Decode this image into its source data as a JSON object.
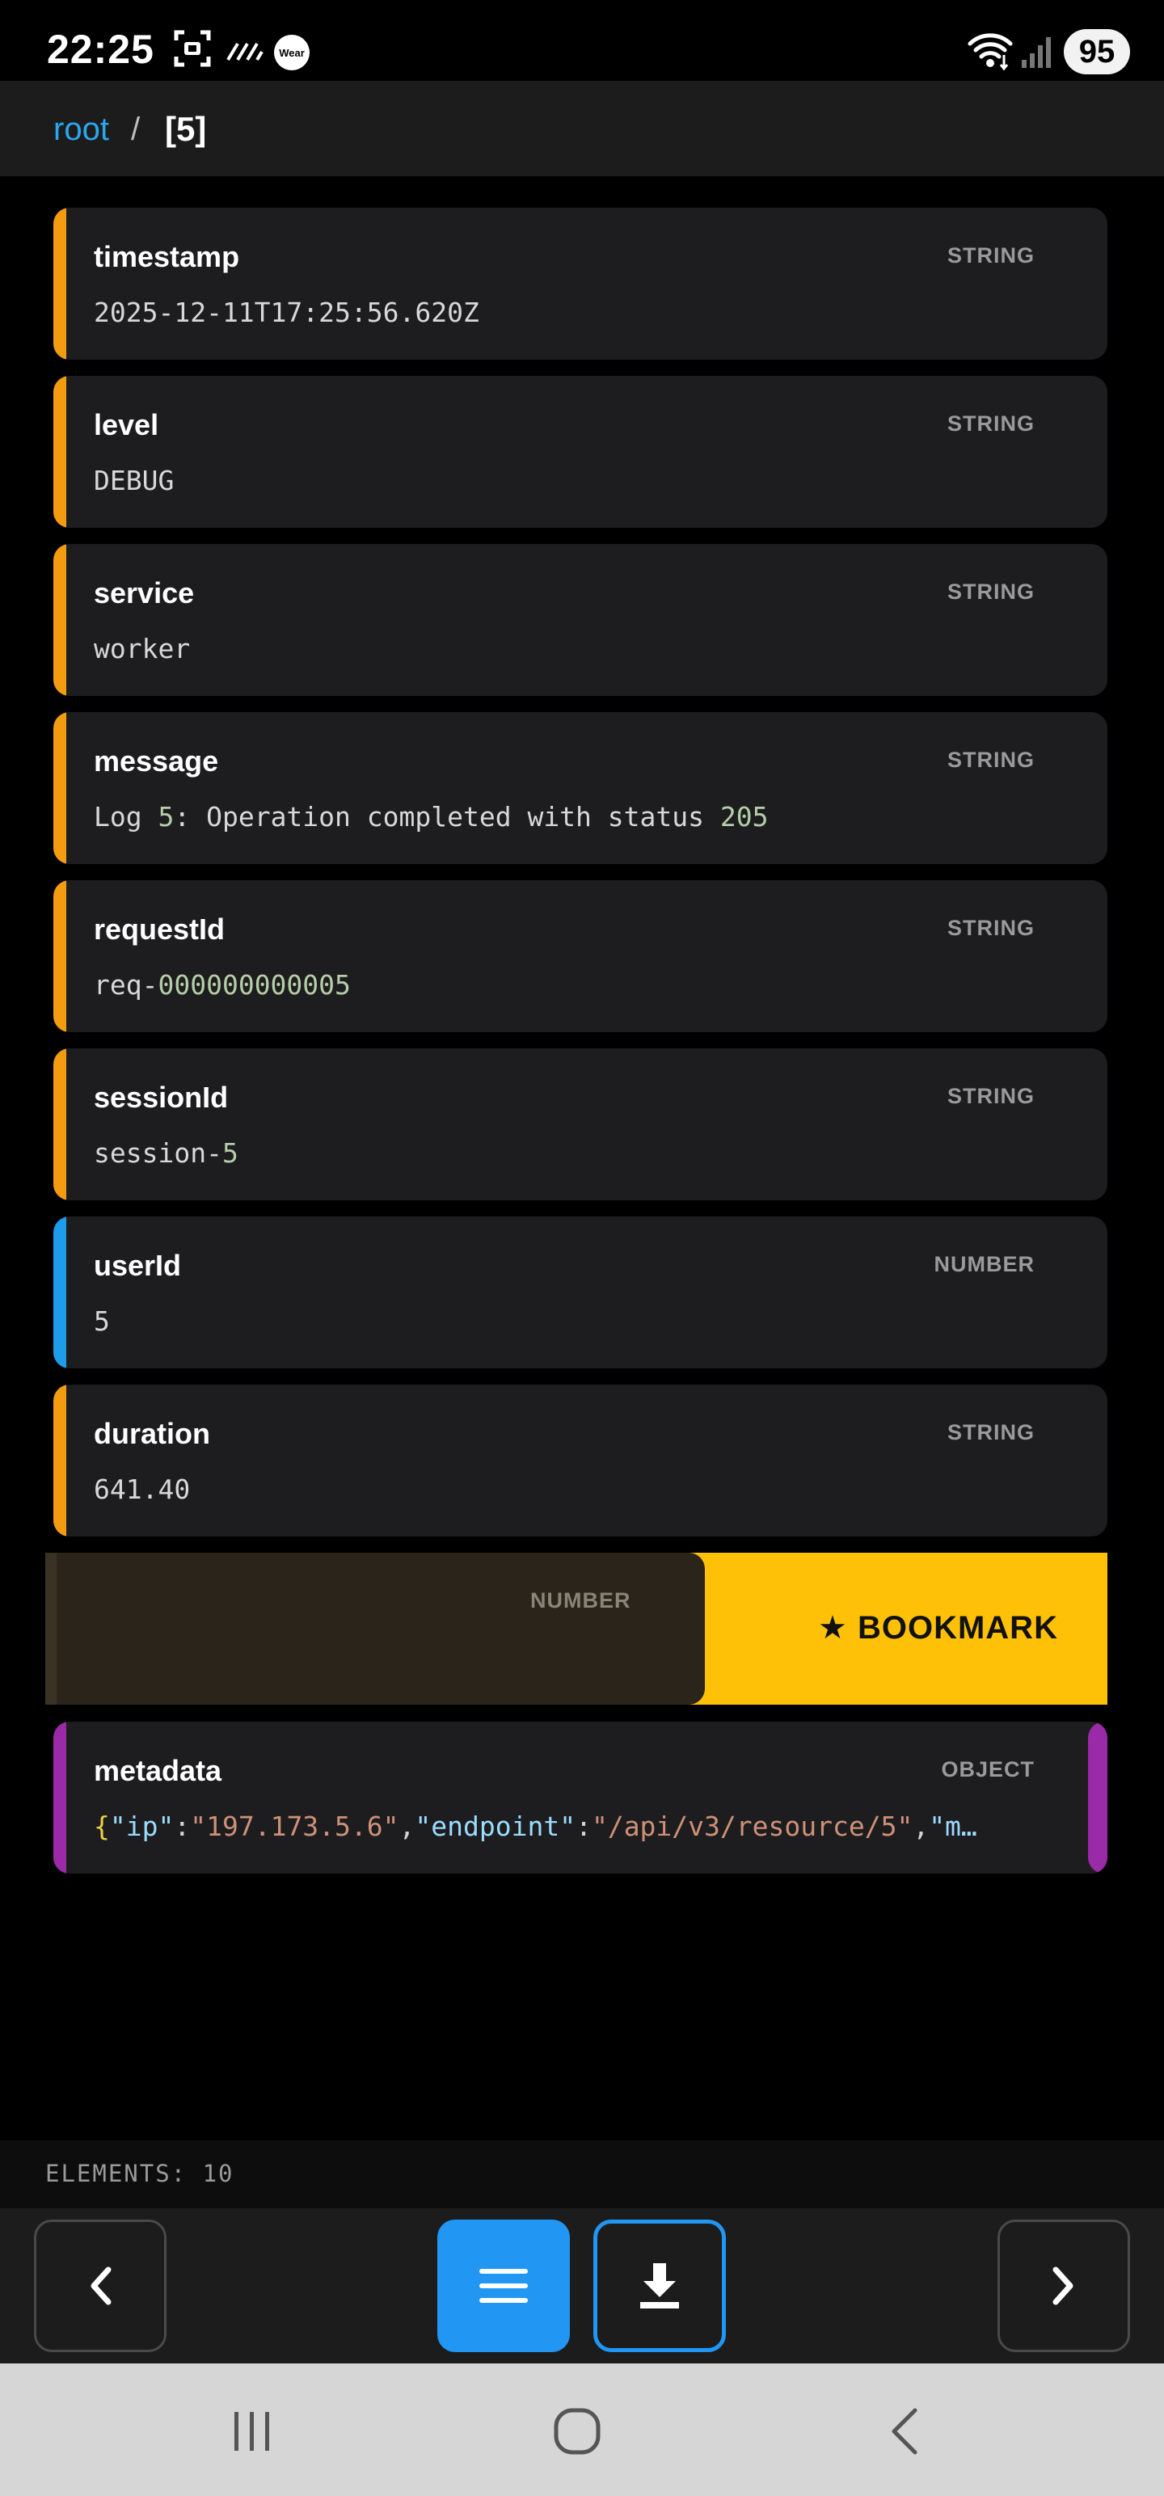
{
  "status_bar": {
    "time": "22:25",
    "battery": "95",
    "icons": [
      "screenshot-icon",
      "signal-stripes-icon",
      "wear-app-icon",
      "wifi-icon",
      "cellular-signal-icon",
      "battery-icon"
    ]
  },
  "breadcrumb": {
    "root": "root",
    "separator": "/",
    "current": "[5]"
  },
  "entries": [
    {
      "key": "timestamp",
      "type": "STRING",
      "value": "2025-12-11T17:25:56.620Z"
    },
    {
      "key": "level",
      "type": "STRING",
      "value": "DEBUG"
    },
    {
      "key": "service",
      "type": "STRING",
      "value": "worker"
    },
    {
      "key": "message",
      "type": "STRING",
      "value_parts": [
        "Log ",
        "5",
        ": Operation completed with status ",
        "205"
      ]
    },
    {
      "key": "requestId",
      "type": "STRING",
      "value_parts": [
        "req-",
        "000000000005"
      ]
    },
    {
      "key": "sessionId",
      "type": "STRING",
      "value_parts": [
        "session-",
        "5"
      ]
    },
    {
      "key": "userId",
      "type": "NUMBER",
      "value": "5"
    },
    {
      "key": "duration",
      "type": "STRING",
      "value": "641.40"
    },
    {
      "key": "",
      "type": "NUMBER",
      "value": "",
      "swipe_action": "★ BOOKMARK"
    },
    {
      "key": "metadata",
      "type": "OBJECT",
      "value_parts": [
        "{",
        "\"ip\"",
        ":",
        "\"197.173.5.6\"",
        ",",
        "\"endpoint\"",
        ":",
        "\"/api/v3/resource/5\"",
        ",",
        "\"m…"
      ]
    }
  ],
  "footer": {
    "elements_count": "ELEMENTS: 10"
  },
  "toolbar": {
    "buttons": [
      "prev-icon",
      "list-icon",
      "download-icon",
      "next-icon"
    ]
  },
  "colors": {
    "accent_blue": "#2196f3",
    "string_bar": "#f39c12",
    "number_bar": "#1e9be9",
    "object_bar": "#9a2aa8",
    "bookmark": "#ffc107"
  }
}
